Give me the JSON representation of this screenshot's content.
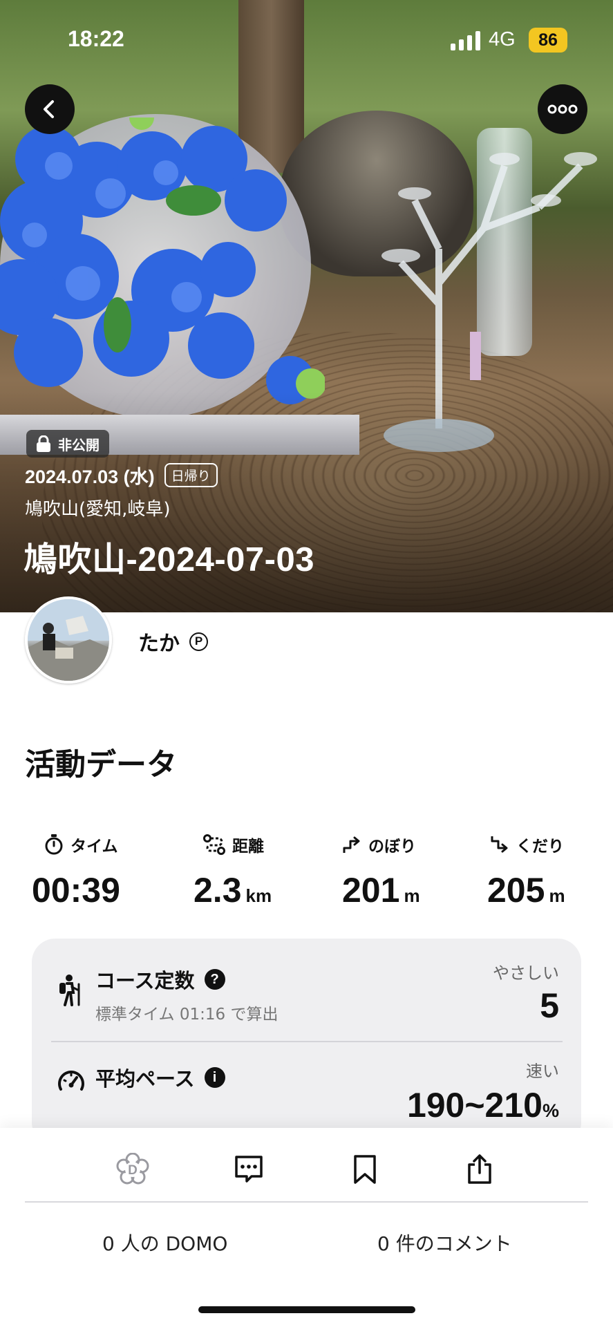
{
  "status_bar": {
    "time": "18:22",
    "network": "4G",
    "battery": "86"
  },
  "hero": {
    "privacy_label": "非公開",
    "date": "2024.07.03 (水)",
    "trip_type": "日帰り",
    "location": "鳩吹山(愛知,岐阜)",
    "title": "鳩吹山-2024-07-03"
  },
  "user": {
    "name": "たか",
    "badge": "P"
  },
  "activity": {
    "section_title": "活動データ",
    "stats": [
      {
        "label": "タイム",
        "value": "00:39",
        "unit": ""
      },
      {
        "label": "距離",
        "value": "2.3",
        "unit": "km"
      },
      {
        "label": "のぼり",
        "value": "201",
        "unit": "m"
      },
      {
        "label": "くだり",
        "value": "205",
        "unit": "m"
      }
    ]
  },
  "course": {
    "title": "コース定数",
    "subtitle": "標準タイム 01:16 で算出",
    "difficulty_label": "やさしい",
    "value": "5"
  },
  "pace": {
    "title": "平均ペース",
    "speed_label": "速い",
    "value": "190~210",
    "unit": "%"
  },
  "actions": {
    "domo_count": "0 人の DOMO",
    "comment_count": "0 件のコメント"
  }
}
